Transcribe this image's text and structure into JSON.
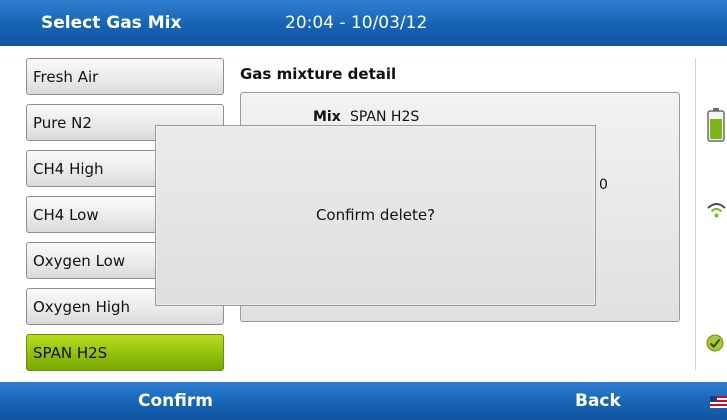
{
  "header": {
    "title": "Select Gas Mix",
    "datetime": "20:04 - 10/03/12"
  },
  "mix_list": {
    "items": [
      {
        "label": "Fresh Air",
        "selected": false
      },
      {
        "label": "Pure N2",
        "selected": false
      },
      {
        "label": "CH4 High",
        "selected": false
      },
      {
        "label": "CH4 Low",
        "selected": false
      },
      {
        "label": "Oxygen Low",
        "selected": false
      },
      {
        "label": "Oxygen High",
        "selected": false
      },
      {
        "label": "SPAN H2S",
        "selected": true
      }
    ],
    "selected_color": "#92c00a"
  },
  "detail": {
    "header": "Gas mixture detail",
    "mix_label": "Mix",
    "mix_value": "SPAN H2S",
    "partial_value": "0"
  },
  "dialog": {
    "message": "Confirm delete?"
  },
  "status_icons": [
    "battery-icon",
    "wifi-icon",
    "check-icon"
  ],
  "footer": {
    "left_softkey": "Confirm",
    "right_softkey": "Back",
    "flag_icon": "us-flag-icon"
  },
  "colors": {
    "bar_blue": "#1763b3",
    "battery_green": "#7cb518"
  }
}
